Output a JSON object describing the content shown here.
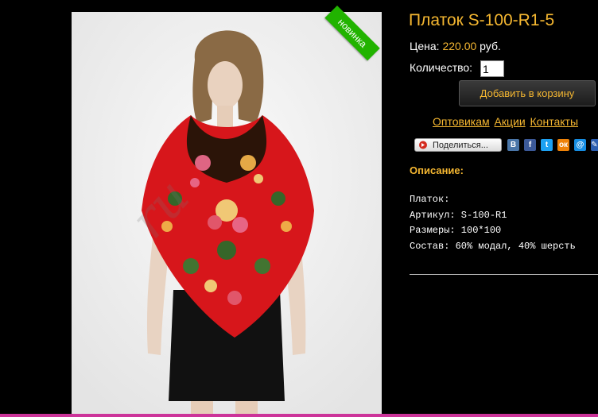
{
  "product": {
    "title": "Платок S-100-R1-5",
    "price_label": "Цена:",
    "price_value": "220.00",
    "price_currency": "руб.",
    "qty_label": "Количество:",
    "qty_value": "1",
    "add_to_cart_label": "Добавить в корзину",
    "badge": "новинка",
    "watermark": "ru"
  },
  "links": [
    "Оптовикам",
    "Акции",
    "Контакты"
  ],
  "share": {
    "button_label": "Поделиться...",
    "icons": [
      {
        "name": "vk-icon",
        "glyph": "В",
        "color": "#4a76a8"
      },
      {
        "name": "facebook-icon",
        "glyph": "f",
        "color": "#3b5998"
      },
      {
        "name": "twitter-icon",
        "glyph": "t",
        "color": "#1da1f2"
      },
      {
        "name": "odnoklassniki-icon",
        "glyph": "ок",
        "color": "#ee8208"
      },
      {
        "name": "mail-icon",
        "glyph": "@",
        "color": "#168de2"
      },
      {
        "name": "livejournal-icon",
        "glyph": "✎",
        "color": "#2a5db0"
      }
    ]
  },
  "description": {
    "heading": "Описание:",
    "lines": [
      "Платок:",
      "Артикул: S-100-R1",
      "Размеры: 100*100",
      "Состав: 60% модал, 40% шерсть"
    ]
  },
  "colors": {
    "accent": "#f5b731",
    "badge": "#21b300",
    "background": "#000000"
  }
}
